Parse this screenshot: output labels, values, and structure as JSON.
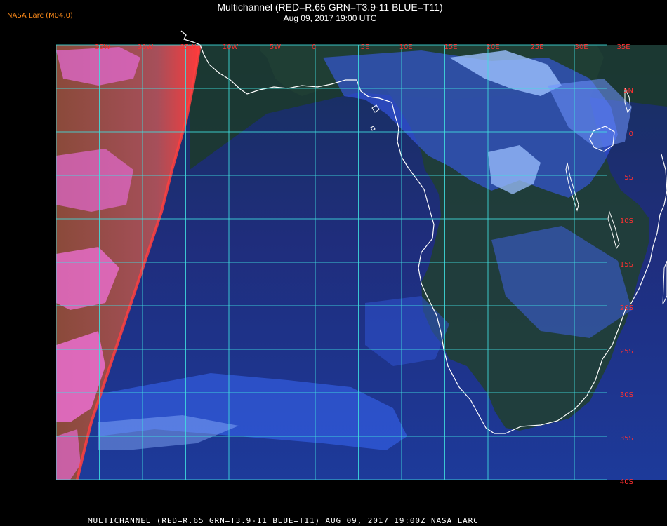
{
  "header": {
    "org_label": "NASA Larc (M04.0)",
    "title": "Multichannel (RED=R.65 GRN=T3.9-11 BLUE=T11)",
    "subtitle": "Aug 09, 2017 19:00 UTC"
  },
  "footer": {
    "caption": "MULTICHANNEL (RED=R.65 GRN=T3.9-11 BLUE=T11) AUG 09, 2017 19:00Z  NASA LARC"
  },
  "map": {
    "longitude_labels": [
      "35W",
      "30W",
      "25W",
      "10W",
      "5W",
      "0",
      "5E",
      "10E",
      "15E",
      "20E",
      "25E",
      "30E",
      "35E"
    ],
    "latitude_labels": [
      "5N",
      "0",
      "5S",
      "10S",
      "15S",
      "20S",
      "25S",
      "30S",
      "35S",
      "40S"
    ],
    "colors": {
      "grid": "#40e0e0",
      "coastline": "#ffffff",
      "ocean_clear": "#1f2a7a",
      "land_clear": "#1e3d22",
      "cloud_low": "#3a5cff",
      "cloud_high": "#9cc0ff",
      "daylight_land": "#7a4a33",
      "daylight_cloud": "#f06ad8",
      "terminator": "#ff4040",
      "label": "#ff3030"
    }
  }
}
